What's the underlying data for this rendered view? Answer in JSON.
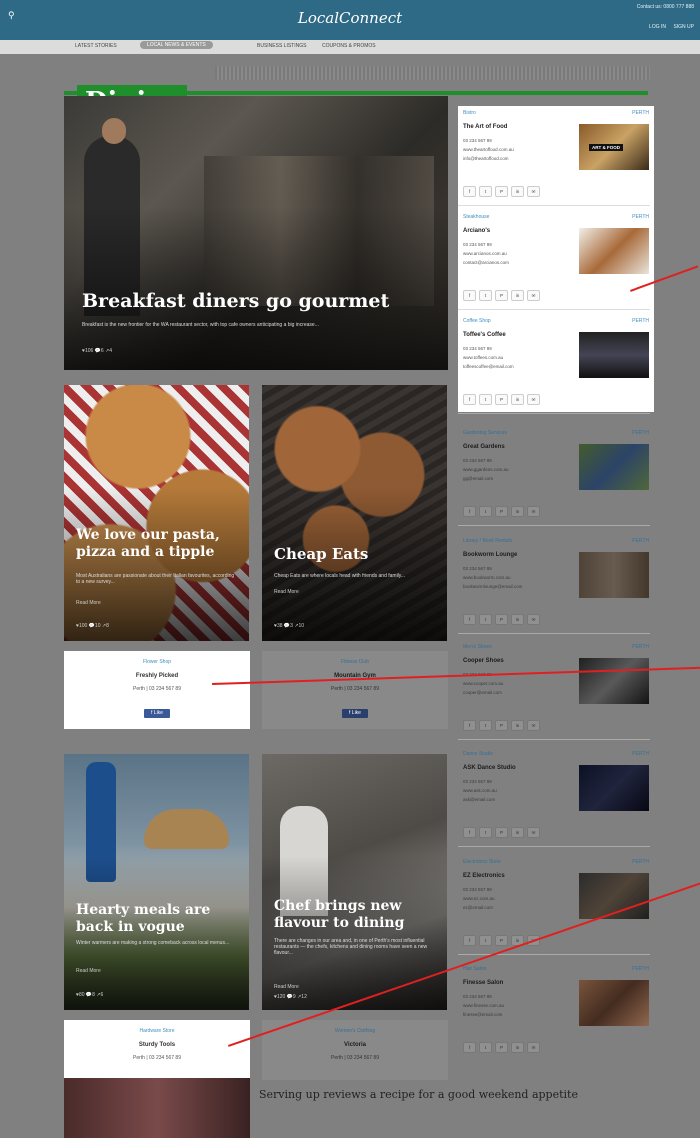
{
  "header": {
    "logo": "LocalConnect",
    "contact": "Contact us: 0800 777 888",
    "login": "LOG IN",
    "signup": "SIGN UP",
    "search_icon": "search-icon"
  },
  "subnav": {
    "items": [
      "LATEST STORIES",
      "LOCAL NEWS & EVENTS",
      "BUSINESS LISTINGS",
      "COUPONS & PROMOS"
    ],
    "active_index": 1
  },
  "section": {
    "title": "Dining"
  },
  "hero": {
    "title": "Breakfast diners go gourmet",
    "teaser": "Breakfast is the new frontier for the WA restaurant sector, with top cafe owners anticipating a big increase...",
    "meta": "♥106  💬6  ↗4"
  },
  "stories": [
    {
      "title": "We love our pasta, pizza and a tipple",
      "teaser": "Most Australians are passionate about their Italian favourites, according to a new survey...",
      "read_more": "Read More",
      "meta": "♥100  💬10  ↗8"
    },
    {
      "title": "Cheap Eats",
      "teaser": "Cheap Eats are where locals head with friends and family...",
      "read_more": "Read More",
      "meta": "♥38  💬3  ↗10"
    },
    {
      "title": "Hearty meals are back in vogue",
      "teaser": "Winter warmers are making a strong comeback across local menus...",
      "read_more": "Read More",
      "meta": "♥80  💬8  ↗6"
    },
    {
      "title": "Chef brings new flavour to dining",
      "teaser": "There are changes in our area and, in one of Perth's most influential restaurants — the chefs, kitchens and dining rooms have seen a new flavour...",
      "read_more": "Read More",
      "meta": "♥120  💬9  ↗12"
    }
  ],
  "cards": [
    {
      "category": "Flower Shop",
      "name": "Freshly Picked",
      "contact": "Perth  |  03 234 567 89",
      "fb": "f Like"
    },
    {
      "category": "Fitness Club",
      "name": "Mountain Gym",
      "contact": "Perth  |  03 234 567 89",
      "fb": "f Like"
    },
    {
      "category": "Hardware Store",
      "name": "Sturdy Tools",
      "contact": "Perth  |  03 234 567 89"
    },
    {
      "category": "Women's Clothing",
      "name": "Victoria",
      "contact": "Perth  |  03 234 567 89"
    }
  ],
  "sidebar": [
    {
      "category": "Bistro",
      "loc": "PERTH",
      "name": "The Art of Food",
      "phone": "03 234 567 89",
      "web": "www.theartoffood.com.au",
      "email": "info@theartoffood.com",
      "thumb_label": "ART & FOOD"
    },
    {
      "category": "Steakhouse",
      "loc": "PERTH",
      "name": "Arciano's",
      "phone": "03 234 567 89",
      "web": "www.arcianos.com.au",
      "email": "contact@arcianos.com"
    },
    {
      "category": "Coffee Shop",
      "loc": "PERTH",
      "name": "Toffee's Coffee",
      "phone": "03 234 567 89",
      "web": "www.toffees.com.au",
      "email": "toffeescoffee@email.com"
    },
    {
      "category": "Gardening Services",
      "loc": "PERTH",
      "name": "Great Gardens",
      "phone": "03 234 567 89",
      "web": "www.ggardens.com.au",
      "email": "gg@email.com"
    },
    {
      "category": "Library / Book Rentals",
      "loc": "PERTH",
      "name": "Bookworm Lounge",
      "phone": "03 234 567 89",
      "web": "www.bookworm.com.au",
      "email": "bookwormlounge@email.com"
    },
    {
      "category": "Men's Shoes",
      "loc": "PERTH",
      "name": "Cooper Shoes",
      "phone": "03 234 567 89",
      "web": "www.cooper.com.au",
      "email": "cooper@email.com"
    },
    {
      "category": "Dance Studio",
      "loc": "PERTH",
      "name": "ASK Dance Studio",
      "phone": "03 234 567 89",
      "web": "www.ask.com.au",
      "email": "ask@email.com"
    },
    {
      "category": "Electronics Store",
      "loc": "PERTH",
      "name": "EZ Electronics",
      "phone": "03 234 567 89",
      "web": "www.ez.com.au",
      "email": "ez@email.com"
    },
    {
      "category": "Hair Salon",
      "loc": "PERTH",
      "name": "Finesse Salon",
      "phone": "03 234 567 89",
      "web": "www.finesse.com.au",
      "email": "finesse@email.com"
    }
  ],
  "social": [
    "f",
    "t",
    "P",
    "in",
    "✉"
  ],
  "bottom": {
    "title": "Serving up reviews a recipe for a good weekend appetite"
  },
  "colors": {
    "brand": "#2e6a86",
    "accent": "#1f8f2c",
    "link": "#3f8fc0",
    "annotation": "#e02020"
  }
}
